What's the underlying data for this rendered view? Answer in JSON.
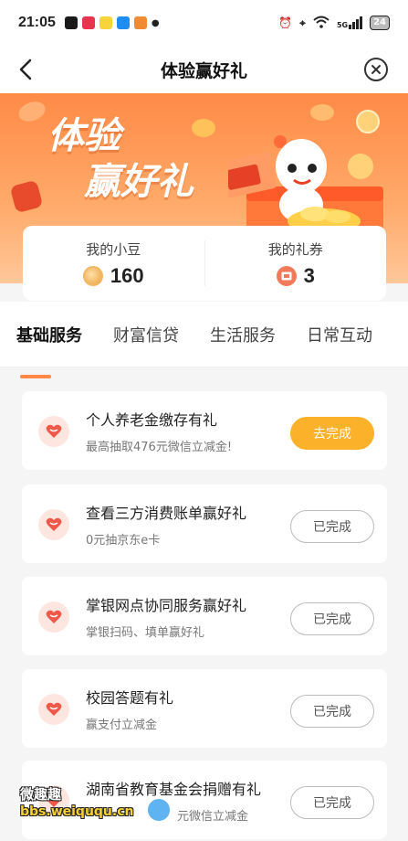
{
  "status_bar": {
    "time": "21:05",
    "signal_label": "5G",
    "battery": "24",
    "app_dot_colors": [
      "#1a1a1a",
      "#e8344f",
      "#f6d43a",
      "#1f8cf2",
      "#f08a33"
    ]
  },
  "nav": {
    "title": "体验赢好礼",
    "back_icon": "chevron-left-icon",
    "close_icon": "close-circle-icon"
  },
  "banner": {
    "title_line1": "体验",
    "title_line2": "赢好礼"
  },
  "stats": {
    "beans_label": "我的小豆",
    "beans_value": "160",
    "coupons_label": "我的礼券",
    "coupons_value": "3"
  },
  "tabs": [
    {
      "label": "基础服务",
      "active": true
    },
    {
      "label": "财富信贷",
      "active": false
    },
    {
      "label": "生活服务",
      "active": false
    },
    {
      "label": "日常互动",
      "active": false
    }
  ],
  "tasks": [
    {
      "title": "个人养老金缴存有礼",
      "subtitle": "最高抽取476元微信立减金!",
      "button": "去完成",
      "status": "todo"
    },
    {
      "title": "查看三方消费账单赢好礼",
      "subtitle": "0元抽京东e卡",
      "button": "已完成",
      "status": "done"
    },
    {
      "title": "掌银网点协同服务赢好礼",
      "subtitle": "掌银扫码、填单赢好礼",
      "button": "已完成",
      "status": "done"
    },
    {
      "title": "校园答题有礼",
      "subtitle": "赢支付立减金",
      "button": "已完成",
      "status": "done"
    },
    {
      "title": "湖南省教育基金会捐赠有礼",
      "subtitle": "元微信立减金",
      "button": "已完成",
      "status": "done"
    }
  ],
  "watermark": {
    "line1": "微趣趣",
    "line2": "bbs.weiququ.cn"
  },
  "colors": {
    "accent_orange": "#ff8a47",
    "button_yellow": "#fbb12a",
    "heart_red": "#f0584a"
  }
}
